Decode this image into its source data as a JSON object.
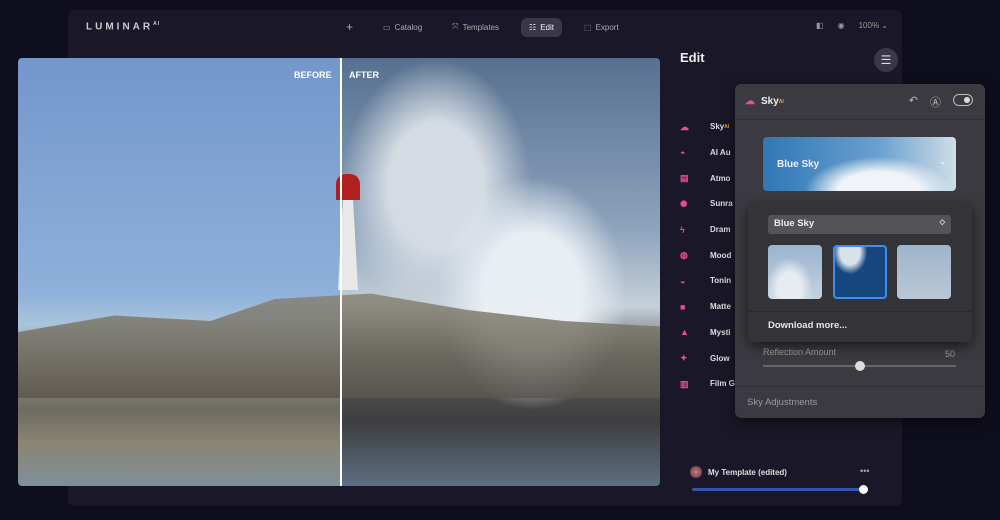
{
  "app": {
    "logo": "LUMINAR",
    "logo_sup": "AI"
  },
  "nav": [
    {
      "icon": "plus-icon",
      "label": ""
    },
    {
      "icon": "catalog-icon",
      "label": "Catalog"
    },
    {
      "icon": "templates-icon",
      "label": "Templates"
    },
    {
      "icon": "edit-icon",
      "label": "Edit",
      "active": true
    },
    {
      "icon": "export-icon",
      "label": "Export"
    }
  ],
  "top_right": {
    "zoom": "100%"
  },
  "photo": {
    "before_label": "BEFORE",
    "after_label": "AFTER"
  },
  "edit": {
    "title": "Edit",
    "tools": [
      {
        "label": "Sky",
        "sup": "AI"
      },
      {
        "label": "AI Au"
      },
      {
        "label": "Atmo"
      },
      {
        "label": "Sunra"
      },
      {
        "label": "Dram"
      },
      {
        "label": "Mood"
      },
      {
        "label": "Tonin"
      },
      {
        "label": "Matte"
      },
      {
        "label": "Mysti"
      },
      {
        "label": "Glow"
      },
      {
        "label": "Film G"
      }
    ]
  },
  "template": {
    "name": "My Template (edited)",
    "amount_percent": 100
  },
  "sky_panel": {
    "title": "Sky",
    "title_sup": "AI",
    "selected_sky": "Blue Sky",
    "reflection_label": "Reflection Amount",
    "reflection_value": "50",
    "sky_adjustments": "Sky Adjustments"
  },
  "dropdown": {
    "selected": "Blue Sky",
    "download_more": "Download more...",
    "thumbnails": 3,
    "selected_thumbnail": 2
  },
  "colors": {
    "accent": "#e94a9b",
    "selection": "#3f8cf0"
  }
}
